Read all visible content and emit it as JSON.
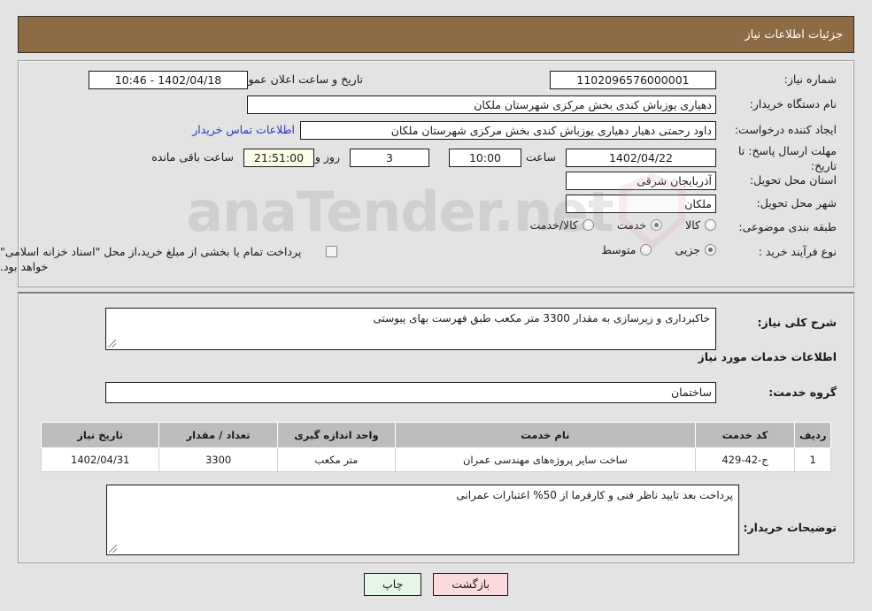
{
  "header": {
    "title": "جزئیات اطلاعات نیاز"
  },
  "top_section": {
    "need_number_label": "شماره نیاز:",
    "need_number_value": "1102096576000001",
    "public_announce_label": "تاریخ و ساعت اعلان عمومی:",
    "public_announce_value": "1402/04/18 - 10:46",
    "buyer_org_label": "نام دستگاه خریدار:",
    "buyer_org_value": "دهیاری یوزباش کندی بخش مرکزی شهرستان ملکان",
    "requester_label": "ایجاد کننده درخواست:",
    "requester_value": "داود رحمتی دهیار دهیاری یوزباش کندی بخش مرکزی شهرستان ملکان",
    "contact_link": "اطلاعات تماس خریدار",
    "deadline_label": "مهلت ارسال پاسخ: تا تاریخ:",
    "deadline_date": "1402/04/22",
    "deadline_hour_label": "ساعت",
    "deadline_hour": "10:00",
    "remaining_days": "3",
    "remaining_days_label": "روز و",
    "remaining_time": "21:51:00",
    "remaining_time_label": "ساعت باقی مانده",
    "province_label": "استان محل تحویل:",
    "province_value": "آذربایجان شرقی",
    "city_label": "شهر محل تحویل:",
    "city_value": "ملکان",
    "category_label": "طبقه بندی موضوعی:",
    "category_options": [
      {
        "label": "کالا",
        "checked": false
      },
      {
        "label": "خدمت",
        "checked": true
      },
      {
        "label": "کالا/خدمت",
        "checked": false
      }
    ],
    "process_label": "نوع فرآیند خرید :",
    "process_options": [
      {
        "label": "جزیی",
        "checked": true
      },
      {
        "label": "متوسط",
        "checked": false
      }
    ],
    "treasury_checkbox_checked": false,
    "treasury_note": "پرداخت تمام یا بخشی از مبلغ خرید،از محل \"اسناد خزانه اسلامی\" خواهد بود."
  },
  "mid_section": {
    "general_desc_label": "شرح کلی نیاز:",
    "general_desc_value": "خاکبرداری و زیرسازی به مقدار 3300 متر مکعب طبق فهرست بهای پیوستی",
    "services_heading": "اطلاعات خدمات مورد نیاز",
    "service_group_label": "گروه خدمت:",
    "service_group_value": "ساختمان",
    "buyer_notes_label": "توضیحات خریدار:",
    "buyer_notes_value": "پرداخت بعد تایید ناظر فنی و کارفرما از 50% اعتبارات عمرانی"
  },
  "table": {
    "columns": [
      "ردیف",
      "کد خدمت",
      "نام خدمت",
      "واحد اندازه گیری",
      "تعداد / مقدار",
      "تاریخ نیاز"
    ],
    "rows": [
      {
        "radif": "1",
        "code": "ج-42-429",
        "name": "ساخت سایر پروژه‌های مهندسی عمران",
        "unit": "متر مکعب",
        "qty": "3300",
        "date": "1402/04/31"
      }
    ]
  },
  "buttons": {
    "print": "چاپ",
    "back": "بازگشت"
  },
  "watermark": {
    "text": "anaTender.net"
  },
  "colors": {
    "header_bg": "#8d6b45",
    "page_bg": "#e3e3e3",
    "link": "#2834c9",
    "print_btn": "#e6f6e6",
    "back_btn": "#fadadd",
    "table_header": "#bdbdbd"
  }
}
